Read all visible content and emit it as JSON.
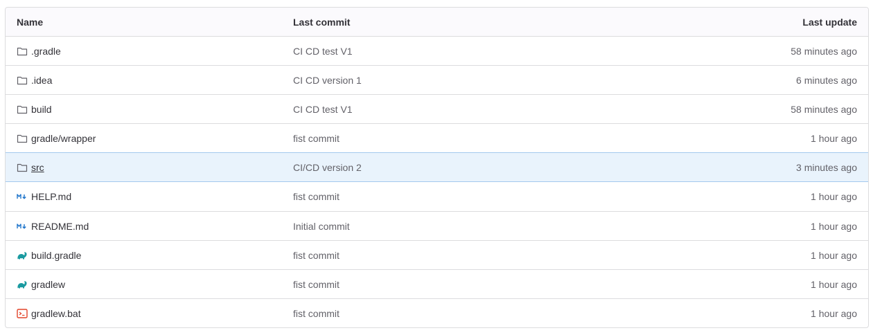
{
  "table": {
    "headers": {
      "name": "Name",
      "last_commit": "Last commit",
      "last_update": "Last update"
    },
    "rows": [
      {
        "icon": "folder-icon",
        "name": ".gradle",
        "commit": "CI CD test V1",
        "updated": "58 minutes ago"
      },
      {
        "icon": "folder-icon",
        "name": ".idea",
        "commit": "CI CD version 1",
        "updated": "6 minutes ago"
      },
      {
        "icon": "folder-icon",
        "name": "build",
        "commit": "CI CD test V1",
        "updated": "58 minutes ago"
      },
      {
        "icon": "folder-icon",
        "name": "gradle/wrapper",
        "commit": "fist commit",
        "updated": "1 hour ago"
      },
      {
        "icon": "folder-icon",
        "name": "src",
        "commit": "CI/CD version 2",
        "updated": "3 minutes ago"
      },
      {
        "icon": "markdown-icon",
        "name": "HELP.md",
        "commit": "fist commit",
        "updated": "1 hour ago"
      },
      {
        "icon": "markdown-icon",
        "name": "README.md",
        "commit": "Initial commit",
        "updated": "1 hour ago"
      },
      {
        "icon": "gradle-icon",
        "name": "build.gradle",
        "commit": "fist commit",
        "updated": "1 hour ago"
      },
      {
        "icon": "gradle-icon",
        "name": "gradlew",
        "commit": "fist commit",
        "updated": "1 hour ago"
      },
      {
        "icon": "terminal-icon",
        "name": "gradlew.bat",
        "commit": "fist commit",
        "updated": "1 hour ago"
      }
    ]
  },
  "colors": {
    "highlight_row": "#e9f3fc",
    "markdown_icon": "#1f75cb",
    "gradle_icon": "#02303a",
    "terminal_icon": "#e24329"
  }
}
